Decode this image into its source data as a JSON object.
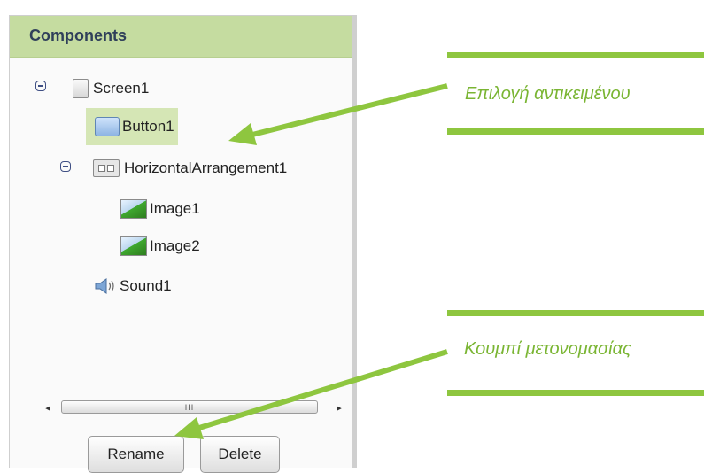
{
  "panel": {
    "title": "Components"
  },
  "tree": {
    "screen": "Screen1",
    "button": "Button1",
    "arrangement": "HorizontalArrangement1",
    "image1": "Image1",
    "image2": "Image2",
    "sound": "Sound1"
  },
  "scrollbar": {
    "left_arrow": "◂",
    "right_arrow": "▸",
    "grip": "III"
  },
  "actions": {
    "rename_label": "Rename",
    "delete_label": "Delete"
  },
  "annotations": {
    "select_object": "Επιλογή αντικειμένου",
    "rename_button": "Κουμπί μετονομασίας"
  },
  "colors": {
    "header_bg": "#c5dca0",
    "selected_bg": "#d5e6b5",
    "accent_green": "#8ec63f",
    "annotation_text": "#7ab533"
  },
  "icons": [
    "collapse-icon",
    "screen-icon",
    "button-component-icon",
    "horizontal-arrangement-icon",
    "image-component-icon",
    "sound-component-icon"
  ]
}
